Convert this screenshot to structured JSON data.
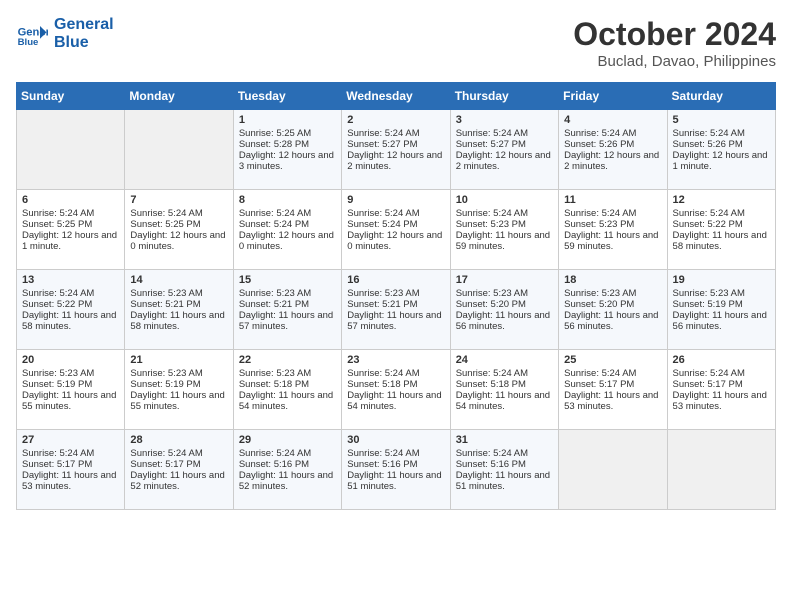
{
  "logo": {
    "line1": "General",
    "line2": "Blue"
  },
  "title": "October 2024",
  "subtitle": "Buclad, Davao, Philippines",
  "days_of_week": [
    "Sunday",
    "Monday",
    "Tuesday",
    "Wednesday",
    "Thursday",
    "Friday",
    "Saturday"
  ],
  "weeks": [
    [
      {
        "day": "",
        "empty": true
      },
      {
        "day": "",
        "empty": true
      },
      {
        "day": "1",
        "sunrise": "5:25 AM",
        "sunset": "5:28 PM",
        "daylight": "12 hours and 3 minutes."
      },
      {
        "day": "2",
        "sunrise": "5:24 AM",
        "sunset": "5:27 PM",
        "daylight": "12 hours and 2 minutes."
      },
      {
        "day": "3",
        "sunrise": "5:24 AM",
        "sunset": "5:27 PM",
        "daylight": "12 hours and 2 minutes."
      },
      {
        "day": "4",
        "sunrise": "5:24 AM",
        "sunset": "5:26 PM",
        "daylight": "12 hours and 2 minutes."
      },
      {
        "day": "5",
        "sunrise": "5:24 AM",
        "sunset": "5:26 PM",
        "daylight": "12 hours and 1 minute."
      }
    ],
    [
      {
        "day": "6",
        "sunrise": "5:24 AM",
        "sunset": "5:25 PM",
        "daylight": "12 hours and 1 minute."
      },
      {
        "day": "7",
        "sunrise": "5:24 AM",
        "sunset": "5:25 PM",
        "daylight": "12 hours and 0 minutes."
      },
      {
        "day": "8",
        "sunrise": "5:24 AM",
        "sunset": "5:24 PM",
        "daylight": "12 hours and 0 minutes."
      },
      {
        "day": "9",
        "sunrise": "5:24 AM",
        "sunset": "5:24 PM",
        "daylight": "12 hours and 0 minutes."
      },
      {
        "day": "10",
        "sunrise": "5:24 AM",
        "sunset": "5:23 PM",
        "daylight": "11 hours and 59 minutes."
      },
      {
        "day": "11",
        "sunrise": "5:24 AM",
        "sunset": "5:23 PM",
        "daylight": "11 hours and 59 minutes."
      },
      {
        "day": "12",
        "sunrise": "5:24 AM",
        "sunset": "5:22 PM",
        "daylight": "11 hours and 58 minutes."
      }
    ],
    [
      {
        "day": "13",
        "sunrise": "5:24 AM",
        "sunset": "5:22 PM",
        "daylight": "11 hours and 58 minutes."
      },
      {
        "day": "14",
        "sunrise": "5:23 AM",
        "sunset": "5:21 PM",
        "daylight": "11 hours and 58 minutes."
      },
      {
        "day": "15",
        "sunrise": "5:23 AM",
        "sunset": "5:21 PM",
        "daylight": "11 hours and 57 minutes."
      },
      {
        "day": "16",
        "sunrise": "5:23 AM",
        "sunset": "5:21 PM",
        "daylight": "11 hours and 57 minutes."
      },
      {
        "day": "17",
        "sunrise": "5:23 AM",
        "sunset": "5:20 PM",
        "daylight": "11 hours and 56 minutes."
      },
      {
        "day": "18",
        "sunrise": "5:23 AM",
        "sunset": "5:20 PM",
        "daylight": "11 hours and 56 minutes."
      },
      {
        "day": "19",
        "sunrise": "5:23 AM",
        "sunset": "5:19 PM",
        "daylight": "11 hours and 56 minutes."
      }
    ],
    [
      {
        "day": "20",
        "sunrise": "5:23 AM",
        "sunset": "5:19 PM",
        "daylight": "11 hours and 55 minutes."
      },
      {
        "day": "21",
        "sunrise": "5:23 AM",
        "sunset": "5:19 PM",
        "daylight": "11 hours and 55 minutes."
      },
      {
        "day": "22",
        "sunrise": "5:23 AM",
        "sunset": "5:18 PM",
        "daylight": "11 hours and 54 minutes."
      },
      {
        "day": "23",
        "sunrise": "5:24 AM",
        "sunset": "5:18 PM",
        "daylight": "11 hours and 54 minutes."
      },
      {
        "day": "24",
        "sunrise": "5:24 AM",
        "sunset": "5:18 PM",
        "daylight": "11 hours and 54 minutes."
      },
      {
        "day": "25",
        "sunrise": "5:24 AM",
        "sunset": "5:17 PM",
        "daylight": "11 hours and 53 minutes."
      },
      {
        "day": "26",
        "sunrise": "5:24 AM",
        "sunset": "5:17 PM",
        "daylight": "11 hours and 53 minutes."
      }
    ],
    [
      {
        "day": "27",
        "sunrise": "5:24 AM",
        "sunset": "5:17 PM",
        "daylight": "11 hours and 53 minutes."
      },
      {
        "day": "28",
        "sunrise": "5:24 AM",
        "sunset": "5:17 PM",
        "daylight": "11 hours and 52 minutes."
      },
      {
        "day": "29",
        "sunrise": "5:24 AM",
        "sunset": "5:16 PM",
        "daylight": "11 hours and 52 minutes."
      },
      {
        "day": "30",
        "sunrise": "5:24 AM",
        "sunset": "5:16 PM",
        "daylight": "11 hours and 51 minutes."
      },
      {
        "day": "31",
        "sunrise": "5:24 AM",
        "sunset": "5:16 PM",
        "daylight": "11 hours and 51 minutes."
      },
      {
        "day": "",
        "empty": true
      },
      {
        "day": "",
        "empty": true
      }
    ]
  ]
}
